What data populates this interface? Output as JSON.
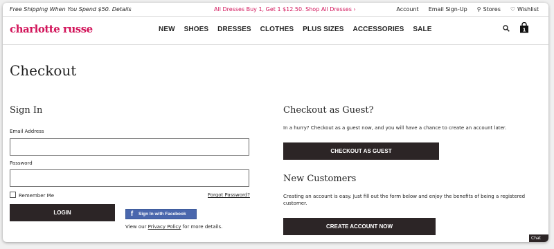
{
  "promo_bar": {
    "shipping": "Free Shipping When You Spend $50. Details",
    "deal": "All Dresses Buy 1, Get 1 $12.50. Shop All Dresses ›",
    "links": {
      "account": "Account",
      "email_signup": "Email Sign-Up",
      "stores": "Stores",
      "wishlist": "Wishlist"
    }
  },
  "header": {
    "logo": "charlotte russe",
    "menu": [
      "NEW",
      "SHOES",
      "DRESSES",
      "CLOTHES",
      "PLUS SIZES",
      "ACCESSORIES",
      "SALE"
    ],
    "bag_count": "1",
    "icons": [
      "search-icon",
      "shopping-bag-icon",
      "pin-icon",
      "heart-icon"
    ]
  },
  "page": {
    "title": "Checkout"
  },
  "sign_in": {
    "heading": "Sign In",
    "email_label": "Email Address",
    "email_value": "",
    "password_label": "Password",
    "password_value": "",
    "remember_me": "Remember Me",
    "remember_checked": false,
    "forgot_password": "Forgot Password?",
    "login_button": "LOGIN",
    "facebook_button": "Sign In with Facebook",
    "privacy_prefix": "View our ",
    "privacy_link": "Privacy Policy",
    "privacy_suffix": " for more details."
  },
  "guest": {
    "heading": "Checkout as Guest?",
    "text": "In a hurry? Checkout as a guest now, and you will have a chance to create an account later.",
    "button": "CHECKOUT AS GUEST"
  },
  "new_customers": {
    "heading": "New Customers",
    "text": "Creating an account is easy. Just fill out the form below and enjoy the benefits of being a registered customer.",
    "button": "CREATE ACCOUNT NOW"
  },
  "chat": {
    "label": "Chat"
  },
  "colors": {
    "brand": "#d2145a",
    "button_dark": "#2c2526",
    "facebook": "#4a67ad"
  }
}
